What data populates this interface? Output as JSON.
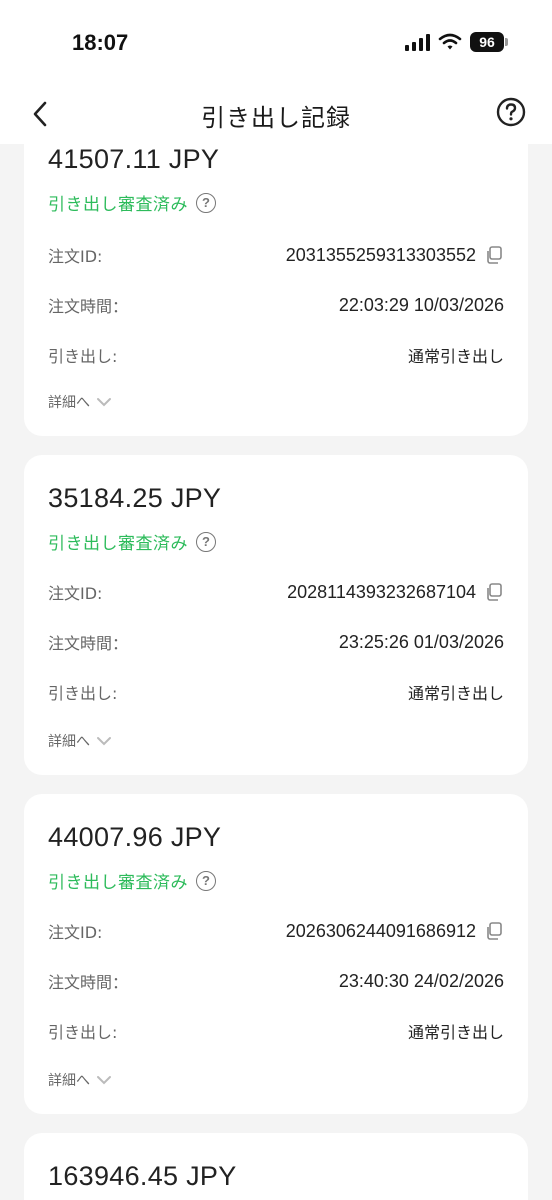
{
  "status_bar": {
    "time": "18:07",
    "battery": "96"
  },
  "header": {
    "title": "引き出し記録"
  },
  "labels": {
    "order_id": "注文ID:",
    "order_time": "注文時間：",
    "withdrawal": "引き出し:",
    "details": "詳細へ"
  },
  "records": [
    {
      "amount": "41507.11 JPY",
      "status": "引き出し審査済み",
      "order_id": "2031355259313303552",
      "order_time": "22:03:29 10/03/2026",
      "withdrawal_type": "通常引き出し"
    },
    {
      "amount": "35184.25 JPY",
      "status": "引き出し審査済み",
      "order_id": "2028114393232687104",
      "order_time": "23:25:26 01/03/2026",
      "withdrawal_type": "通常引き出し"
    },
    {
      "amount": "44007.96 JPY",
      "status": "引き出し審査済み",
      "order_id": "2026306244091686912",
      "order_time": "23:40:30 24/02/2026",
      "withdrawal_type": "通常引き出し"
    },
    {
      "amount": "163946.45 JPY"
    }
  ],
  "colors": {
    "status_green": "#2dbb5b",
    "card_bg": "#ffffff",
    "page_bg": "#f4f4f4"
  },
  "icons": {
    "back": "chevron-left-icon",
    "help": "question-circle-icon",
    "copy": "copy-icon",
    "expand": "chevron-down-icon"
  }
}
